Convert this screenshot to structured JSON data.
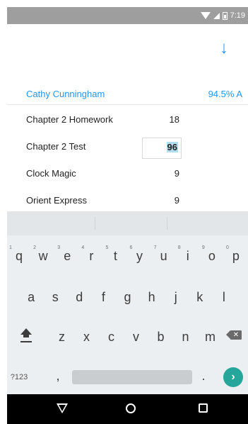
{
  "status_bar": {
    "time": "7:19",
    "icons": [
      "wifi-icon",
      "signal-icon",
      "battery-icon"
    ]
  },
  "app_bar": {
    "download_icon": "arrow-down-icon",
    "download_glyph": "↓"
  },
  "student": {
    "name": "Cathy Cunningham",
    "score": "94.5%  A"
  },
  "grades": [
    {
      "name": "Chapter 2 Homework",
      "value": "18",
      "editing": false
    },
    {
      "name": "Chapter 2 Test",
      "value": "96",
      "editing": true
    },
    {
      "name": "Clock Magic",
      "value": "9",
      "editing": false
    },
    {
      "name": "Orient Express",
      "value": "9",
      "editing": false
    }
  ],
  "keyboard": {
    "row1": [
      "q",
      "w",
      "e",
      "r",
      "t",
      "y",
      "u",
      "i",
      "o",
      "p"
    ],
    "row1_hints": [
      "1",
      "2",
      "3",
      "4",
      "5",
      "6",
      "7",
      "8",
      "9",
      "0"
    ],
    "row2": [
      "a",
      "s",
      "d",
      "f",
      "g",
      "h",
      "j",
      "k",
      "l"
    ],
    "row3": [
      "z",
      "x",
      "c",
      "v",
      "b",
      "n",
      "m"
    ],
    "symbols_label": "?123",
    "comma": ",",
    "period": ".",
    "backspace_glyph": "✕",
    "enter_glyph": "›",
    "enter_color": "#26a69a"
  },
  "nav_bar": {
    "icons": [
      "back-icon",
      "home-icon",
      "recents-icon"
    ]
  },
  "colors": {
    "accent": "#2196f3",
    "status_bar": "#9e9e9e",
    "selection": "#b4dcef"
  }
}
